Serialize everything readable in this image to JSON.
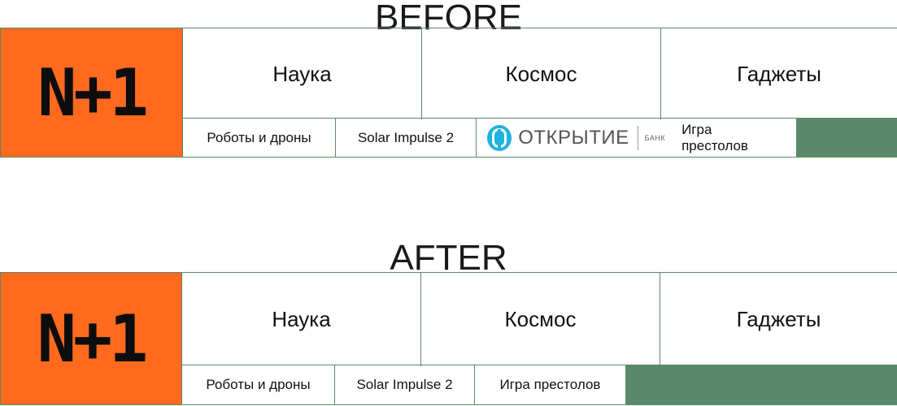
{
  "captions": {
    "before": "BEFORE",
    "after": "AFTER"
  },
  "logo": {
    "text": "N+1"
  },
  "nav": {
    "science": "Наука",
    "space": "Космос",
    "gadgets": "Гаджеты"
  },
  "subnav": {
    "robots": "Роботы и дроны",
    "solar": "Solar Impulse 2",
    "got": "Игра престолов"
  },
  "sponsor": {
    "name": "ОТКРЫТИЕ",
    "sub": "БАНК"
  },
  "colors": {
    "logo_bg": "#ff6a1f",
    "accent_green": "#5a8a6a",
    "sponsor_blue": "#1fb3dd"
  }
}
